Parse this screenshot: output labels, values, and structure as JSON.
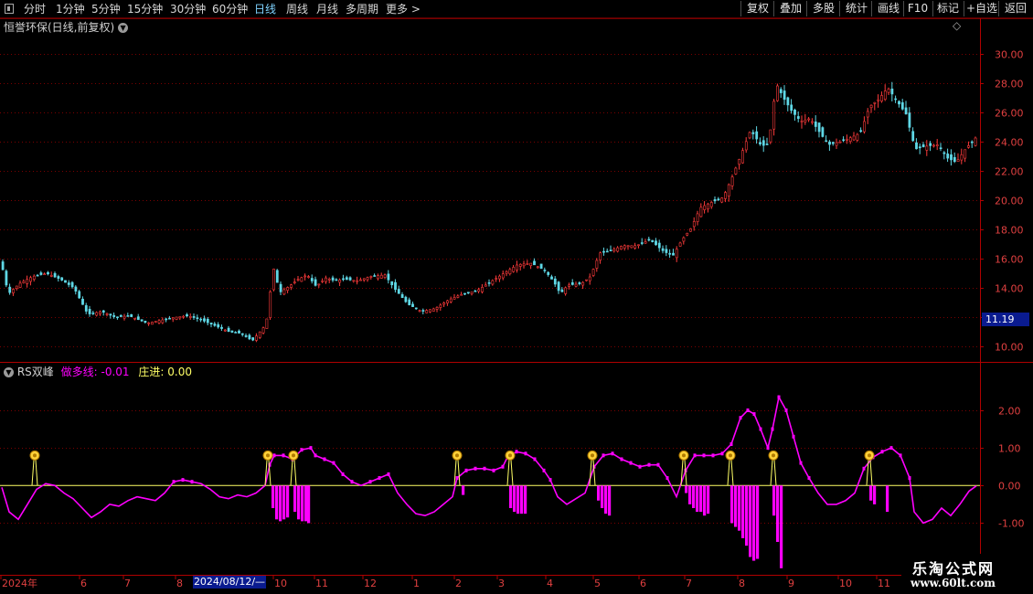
{
  "toolbar": {
    "periods": [
      "分时",
      "1分钟",
      "5分钟",
      "15分钟",
      "30分钟",
      "60分钟",
      "日线",
      "周线",
      "月线",
      "多周期",
      "更多"
    ],
    "active_period": "日线",
    "more_arrow": ">",
    "right_buttons": [
      "复权",
      "叠加",
      "多股",
      "统计",
      "画线",
      "F10",
      "标记",
      "+自选",
      "返回"
    ]
  },
  "main_panel": {
    "title": "恒誉环保(日线,前复权)",
    "current_price_tag": "11.19",
    "diamond": "◇"
  },
  "indicator_panel": {
    "name": "RS双峰",
    "line1_label": "做多线:",
    "line1_value": "-0.01",
    "line2_label": "庄进:",
    "line2_value": "0.00"
  },
  "x_axis": {
    "labels": [
      "2024年",
      "6",
      "7",
      "8",
      "10",
      "11",
      "12",
      "1",
      "2",
      "3",
      "4",
      "5",
      "6",
      "7",
      "8",
      "9",
      "10",
      "11"
    ],
    "cursor_date": "2024/08/12/—"
  },
  "watermark": {
    "title": "乐淘公式网",
    "url": "www.60lt.com"
  },
  "colors": {
    "up": "#ff3b3b",
    "down": "#5fd8e6",
    "grid": "#7a0000",
    "axis": "#b00000",
    "indicator_line": "#ff00ff",
    "zero_line": "#ffff66",
    "marker": "#ffd23a"
  },
  "chart_data": [
    {
      "type": "candlestick",
      "title": "恒誉环保(日线,前复权)",
      "y_ticks": [
        10.0,
        12.0,
        14.0,
        16.0,
        18.0,
        20.0,
        22.0,
        24.0,
        26.0,
        28.0,
        30.0
      ],
      "ylim": [
        9.2,
        31.2
      ],
      "x_labels": [
        "2024年",
        "6",
        "7",
        "8",
        "10",
        "11",
        "12",
        "1",
        "2",
        "3",
        "4",
        "5",
        "6",
        "7",
        "8",
        "9",
        "10",
        "11"
      ],
      "last_price": 11.19,
      "close_path": [
        [
          0,
          15.8
        ],
        [
          8,
          13.6
        ],
        [
          20,
          14.3
        ],
        [
          35,
          14.8
        ],
        [
          50,
          15.0
        ],
        [
          65,
          14.6
        ],
        [
          80,
          14.0
        ],
        [
          95,
          12.2
        ],
        [
          110,
          12.4
        ],
        [
          125,
          12.0
        ],
        [
          140,
          12.1
        ],
        [
          160,
          11.6
        ],
        [
          175,
          11.8
        ],
        [
          190,
          12.0
        ],
        [
          205,
          12.1
        ],
        [
          220,
          11.8
        ],
        [
          235,
          11.4
        ],
        [
          250,
          11.0
        ],
        [
          262,
          10.9
        ],
        [
          275,
          10.4
        ],
        [
          290,
          11.5
        ],
        [
          298,
          15.4
        ],
        [
          305,
          13.7
        ],
        [
          315,
          14.1
        ],
        [
          325,
          14.6
        ],
        [
          335,
          14.9
        ],
        [
          345,
          14.1
        ],
        [
          355,
          14.7
        ],
        [
          365,
          14.5
        ],
        [
          375,
          14.6
        ],
        [
          390,
          14.5
        ],
        [
          405,
          14.8
        ],
        [
          420,
          14.9
        ],
        [
          430,
          14.0
        ],
        [
          445,
          12.9
        ],
        [
          460,
          12.4
        ],
        [
          475,
          12.6
        ],
        [
          490,
          13.2
        ],
        [
          505,
          13.6
        ],
        [
          520,
          13.8
        ],
        [
          535,
          14.4
        ],
        [
          550,
          15.0
        ],
        [
          565,
          15.6
        ],
        [
          580,
          15.7
        ],
        [
          595,
          15.2
        ],
        [
          605,
          14.4
        ],
        [
          612,
          13.6
        ],
        [
          620,
          14.2
        ],
        [
          635,
          14.3
        ],
        [
          645,
          14.8
        ],
        [
          655,
          16.4
        ],
        [
          665,
          16.5
        ],
        [
          680,
          16.9
        ],
        [
          695,
          16.9
        ],
        [
          710,
          17.3
        ],
        [
          725,
          16.5
        ],
        [
          735,
          16.2
        ],
        [
          745,
          17.3
        ],
        [
          755,
          18.1
        ],
        [
          765,
          19.5
        ],
        [
          775,
          19.8
        ],
        [
          790,
          20.2
        ],
        [
          800,
          21.6
        ],
        [
          812,
          23.5
        ],
        [
          820,
          24.8
        ],
        [
          832,
          23.7
        ],
        [
          840,
          23.9
        ],
        [
          848,
          28.0
        ],
        [
          856,
          27.0
        ],
        [
          865,
          26.1
        ],
        [
          875,
          25.4
        ],
        [
          885,
          25.6
        ],
        [
          895,
          24.7
        ],
        [
          905,
          23.8
        ],
        [
          918,
          24.0
        ],
        [
          930,
          24.3
        ],
        [
          940,
          24.6
        ],
        [
          950,
          26.4
        ],
        [
          960,
          26.9
        ],
        [
          970,
          27.7
        ],
        [
          980,
          26.8
        ],
        [
          990,
          25.9
        ],
        [
          1000,
          23.5
        ],
        [
          1012,
          23.7
        ],
        [
          1025,
          23.8
        ],
        [
          1035,
          22.9
        ],
        [
          1045,
          22.6
        ],
        [
          1055,
          23.5
        ],
        [
          1068,
          24.4
        ]
      ]
    },
    {
      "type": "line",
      "title": "RS双峰",
      "y_ticks": [
        -1.0,
        0.0,
        1.0,
        2.0
      ],
      "ylim": [
        -2.35,
        2.85
      ],
      "series": [
        {
          "name": "做多线",
          "points": [
            [
              2,
              -0.05
            ],
            [
              10,
              -0.7
            ],
            [
              20,
              -0.9
            ],
            [
              30,
              -0.5
            ],
            [
              40,
              -0.1
            ],
            [
              50,
              0.05
            ],
            [
              60,
              0.0
            ],
            [
              70,
              -0.2
            ],
            [
              80,
              -0.35
            ],
            [
              90,
              -0.6
            ],
            [
              100,
              -0.85
            ],
            [
              110,
              -0.7
            ],
            [
              120,
              -0.5
            ],
            [
              130,
              -0.55
            ],
            [
              140,
              -0.4
            ],
            [
              150,
              -0.3
            ],
            [
              160,
              -0.35
            ],
            [
              170,
              -0.4
            ],
            [
              180,
              -0.2
            ],
            [
              190,
              0.1
            ],
            [
              200,
              0.15
            ],
            [
              210,
              0.1
            ],
            [
              220,
              0.05
            ],
            [
              230,
              -0.1
            ],
            [
              240,
              -0.3
            ],
            [
              250,
              -0.35
            ],
            [
              260,
              -0.25
            ],
            [
              270,
              -0.3
            ],
            [
              280,
              -0.2
            ],
            [
              290,
              0.0
            ],
            [
              295,
              0.55
            ],
            [
              300,
              0.8
            ],
            [
              310,
              0.8
            ],
            [
              320,
              0.7
            ],
            [
              330,
              0.95
            ],
            [
              340,
              1.0
            ],
            [
              345,
              0.8
            ],
            [
              355,
              0.7
            ],
            [
              365,
              0.6
            ],
            [
              375,
              0.3
            ],
            [
              385,
              0.1
            ],
            [
              395,
              0.0
            ],
            [
              405,
              0.1
            ],
            [
              415,
              0.2
            ],
            [
              425,
              0.3
            ],
            [
              435,
              -0.2
            ],
            [
              445,
              -0.5
            ],
            [
              455,
              -0.75
            ],
            [
              465,
              -0.8
            ],
            [
              475,
              -0.7
            ],
            [
              485,
              -0.5
            ],
            [
              495,
              -0.3
            ],
            [
              500,
              0.2
            ],
            [
              510,
              0.4
            ],
            [
              520,
              0.45
            ],
            [
              530,
              0.45
            ],
            [
              540,
              0.4
            ],
            [
              550,
              0.5
            ],
            [
              555,
              0.75
            ],
            [
              565,
              0.9
            ],
            [
              575,
              0.85
            ],
            [
              585,
              0.7
            ],
            [
              595,
              0.4
            ],
            [
              602,
              0.15
            ],
            [
              610,
              -0.3
            ],
            [
              620,
              -0.5
            ],
            [
              630,
              -0.35
            ],
            [
              640,
              -0.2
            ],
            [
              650,
              0.5
            ],
            [
              660,
              0.8
            ],
            [
              670,
              0.85
            ],
            [
              680,
              0.7
            ],
            [
              690,
              0.6
            ],
            [
              700,
              0.5
            ],
            [
              710,
              0.55
            ],
            [
              720,
              0.55
            ],
            [
              730,
              0.2
            ],
            [
              740,
              -0.3
            ],
            [
              750,
              0.4
            ],
            [
              760,
              0.8
            ],
            [
              770,
              0.8
            ],
            [
              780,
              0.8
            ],
            [
              790,
              0.85
            ],
            [
              800,
              1.1
            ],
            [
              810,
              1.8
            ],
            [
              818,
              2.0
            ],
            [
              825,
              1.9
            ],
            [
              832,
              1.5
            ],
            [
              840,
              1.0
            ],
            [
              845,
              1.5
            ],
            [
              852,
              2.35
            ],
            [
              860,
              2.0
            ],
            [
              868,
              1.3
            ],
            [
              876,
              0.6
            ],
            [
              885,
              0.2
            ],
            [
              895,
              -0.2
            ],
            [
              905,
              -0.5
            ],
            [
              915,
              -0.5
            ],
            [
              925,
              -0.4
            ],
            [
              935,
              -0.2
            ],
            [
              945,
              0.45
            ],
            [
              955,
              0.75
            ],
            [
              965,
              0.9
            ],
            [
              975,
              1.0
            ],
            [
              985,
              0.8
            ],
            [
              995,
              0.2
            ],
            [
              1000,
              -0.7
            ],
            [
              1010,
              -1.0
            ],
            [
              1020,
              -0.9
            ],
            [
              1030,
              -0.6
            ],
            [
              1040,
              -0.8
            ],
            [
              1050,
              -0.5
            ],
            [
              1060,
              -0.15
            ],
            [
              1068,
              -0.01
            ]
          ]
        }
      ],
      "bars_name": "庄进",
      "bars": [
        [
          297,
          -0.6
        ],
        [
          301,
          -0.9
        ],
        [
          305,
          -0.95
        ],
        [
          309,
          -0.9
        ],
        [
          313,
          -0.85
        ],
        [
          321,
          -0.7
        ],
        [
          325,
          -0.9
        ],
        [
          329,
          -0.95
        ],
        [
          333,
          -0.95
        ],
        [
          336,
          -1.0
        ],
        [
          505,
          -0.25
        ],
        [
          557,
          -0.6
        ],
        [
          561,
          -0.7
        ],
        [
          565,
          -0.75
        ],
        [
          569,
          -0.75
        ],
        [
          573,
          -0.75
        ],
        [
          653,
          -0.4
        ],
        [
          657,
          -0.6
        ],
        [
          661,
          -0.75
        ],
        [
          665,
          -0.8
        ],
        [
          749,
          -0.2
        ],
        [
          753,
          -0.5
        ],
        [
          757,
          -0.6
        ],
        [
          761,
          -0.7
        ],
        [
          765,
          -0.7
        ],
        [
          769,
          -0.8
        ],
        [
          773,
          -0.75
        ],
        [
          799,
          -1.0
        ],
        [
          803,
          -1.1
        ],
        [
          807,
          -1.2
        ],
        [
          811,
          -1.4
        ],
        [
          815,
          -1.6
        ],
        [
          819,
          -1.9
        ],
        [
          823,
          -2.0
        ],
        [
          827,
          -1.95
        ],
        [
          845,
          -0.8
        ],
        [
          849,
          -1.5
        ],
        [
          853,
          -2.2
        ],
        [
          951,
          -0.4
        ],
        [
          955,
          -0.5
        ],
        [
          969,
          -0.7
        ]
      ],
      "markers_x": [
        38,
        293,
        321,
        500,
        558,
        648,
        748,
        799,
        846,
        951
      ]
    }
  ]
}
